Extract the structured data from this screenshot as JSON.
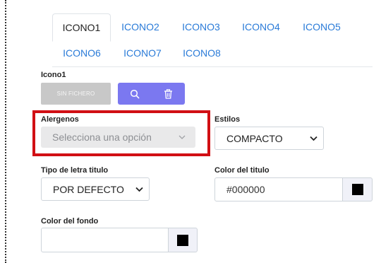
{
  "tabs": [
    {
      "label": "ICONO1",
      "active": true
    },
    {
      "label": "ICONO2",
      "active": false
    },
    {
      "label": "ICONO3",
      "active": false
    },
    {
      "label": "ICONO4",
      "active": false
    },
    {
      "label": "ICONO5",
      "active": false
    },
    {
      "label": "ICONO6",
      "active": false
    },
    {
      "label": "ICONO7",
      "active": false
    },
    {
      "label": "ICONO8",
      "active": false
    }
  ],
  "icon_field": {
    "label": "Icono1",
    "file_placeholder": "SIN FICHERO",
    "search_icon": "search-icon",
    "delete_icon": "trash-icon",
    "button_color": "#7b78f0"
  },
  "allergens": {
    "label": "Alergenos",
    "placeholder": "Selecciona una opción",
    "highlight_color": "#d10f14"
  },
  "styles": {
    "label": "Estilos",
    "value": "COMPACTO"
  },
  "title_font": {
    "label": "Tipo de letra titulo",
    "value": "POR DEFECTO"
  },
  "title_color": {
    "label": "Color del titulo",
    "value": "#000000",
    "swatch": "#000000"
  },
  "background_color": {
    "label": "Color del fondo",
    "value": "",
    "swatch": "#000000"
  },
  "colors": {
    "tab_link": "#2a7bd8",
    "disabled_bg": "#e9e9ea"
  }
}
